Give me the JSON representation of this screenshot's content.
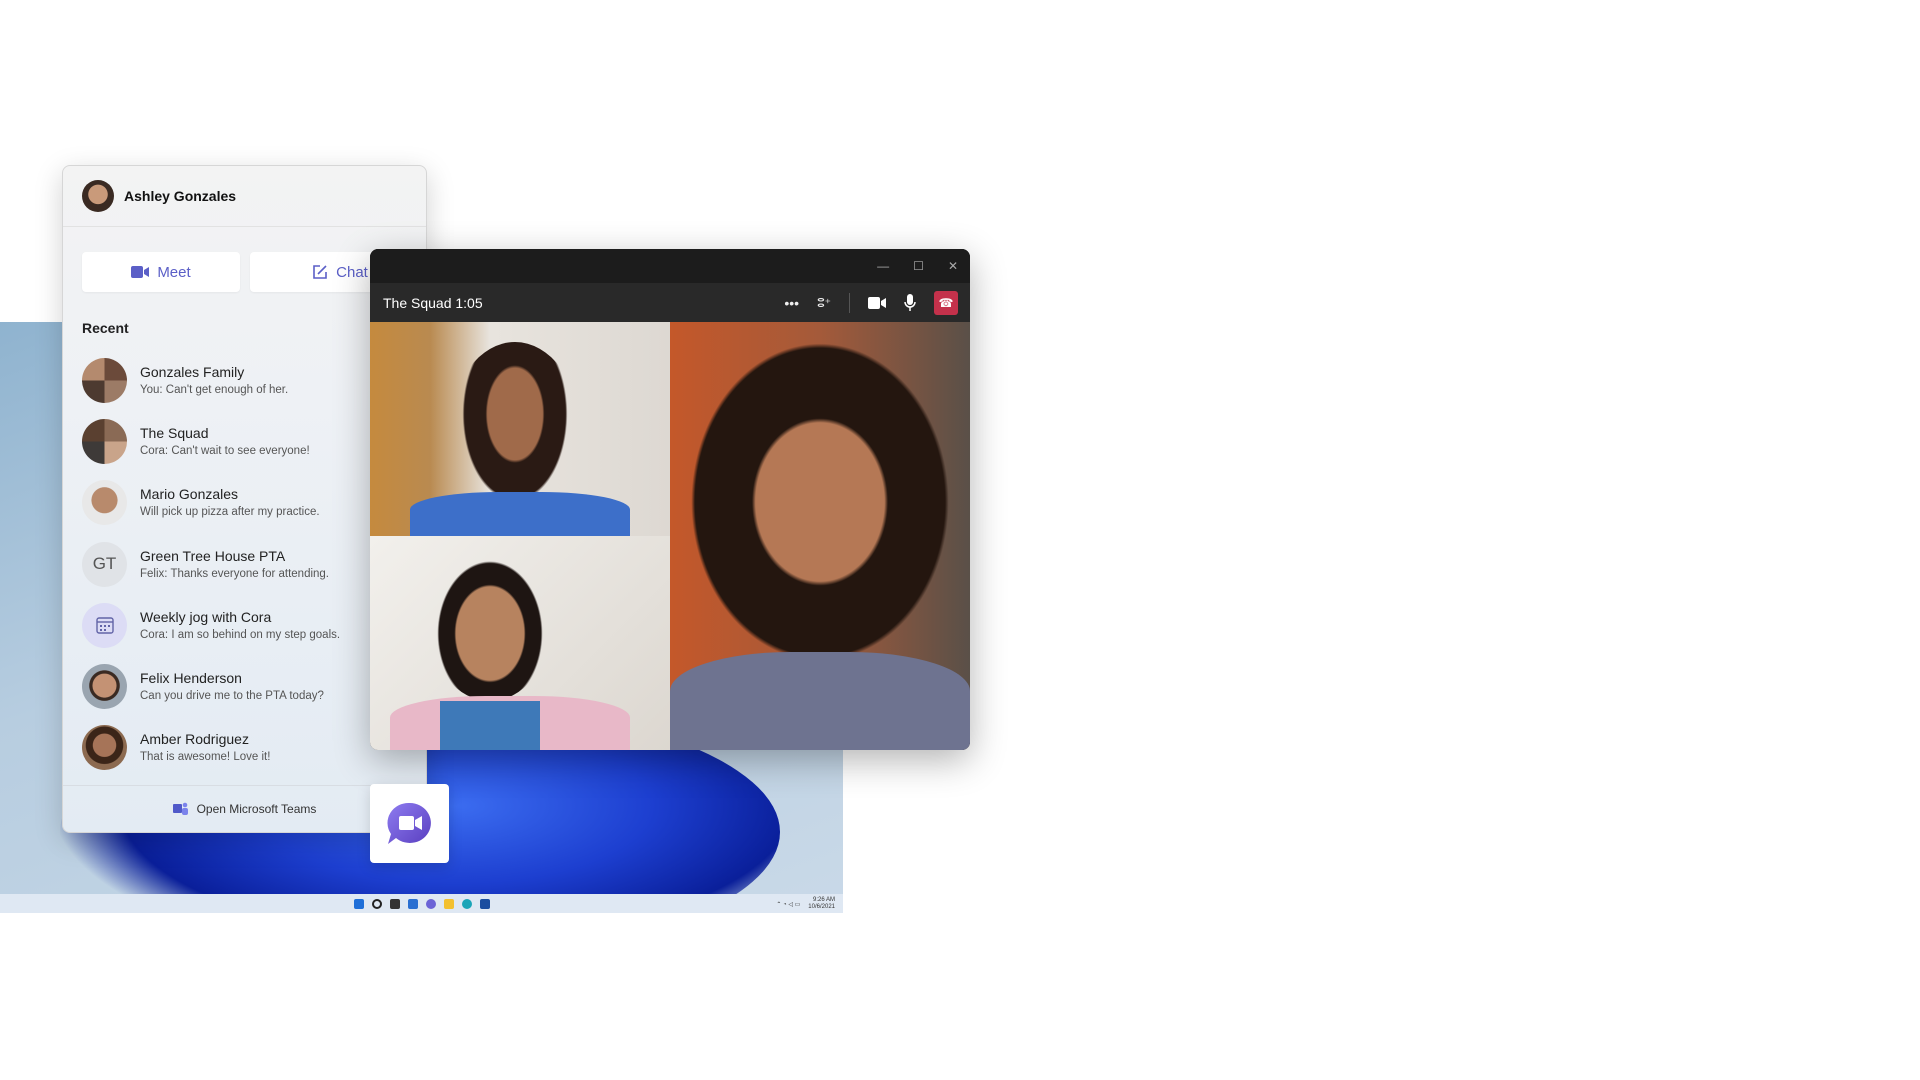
{
  "user": {
    "name": "Ashley Gonzales"
  },
  "actions": {
    "meet": "Meet",
    "chat": "Chat"
  },
  "recent": {
    "heading": "Recent",
    "items": [
      {
        "name": "Gonzales Family",
        "preview": "You: Can't get enough of her.",
        "avatar": "group-photo"
      },
      {
        "name": "The Squad",
        "preview": "Cora: Can't wait to see everyone!",
        "avatar": "group-photo"
      },
      {
        "name": "Mario Gonzales",
        "preview": "Will pick up pizza after my practice.",
        "avatar": "photo"
      },
      {
        "name": "Green Tree House PTA",
        "preview": "Felix: Thanks everyone for attending.",
        "avatar": "GT"
      },
      {
        "name": "Weekly jog with Cora",
        "preview": "Cora: I am so behind on my step goals.",
        "avatar": "calendar-icon"
      },
      {
        "name": "Felix Henderson",
        "preview": "Can you drive me to the PTA today?",
        "avatar": "photo"
      },
      {
        "name": "Amber Rodriguez",
        "preview": "That is awesome! Love it!",
        "avatar": "photo"
      }
    ]
  },
  "footer": {
    "open_teams": "Open Microsoft Teams"
  },
  "call": {
    "title": "The Squad 1:05"
  },
  "taskbar": {
    "time": "9:26 AM",
    "date": "10/6/2021"
  },
  "colors": {
    "accent": "#5b5fc7",
    "hangup": "#c4314b",
    "call_bg": "#292929"
  }
}
